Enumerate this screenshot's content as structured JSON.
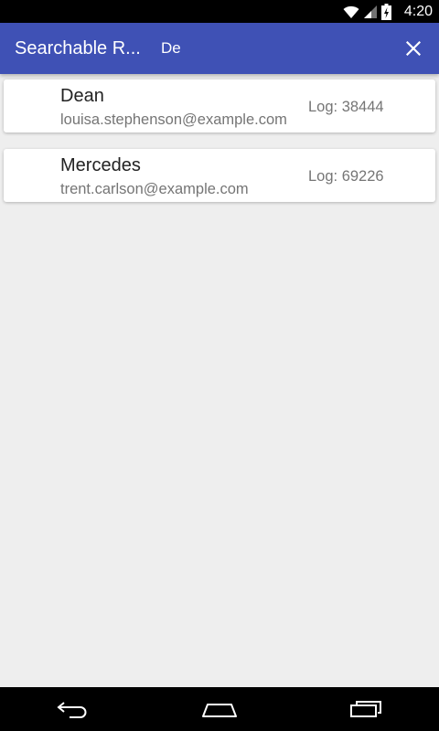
{
  "status_bar": {
    "time": "4:20",
    "icons": [
      "wifi-icon",
      "signal-icon",
      "battery-charging-icon"
    ]
  },
  "app_bar": {
    "title": "Searchable R...",
    "search_value": "De",
    "close_icon": "close-icon",
    "color": "#3f51b5"
  },
  "results": [
    {
      "name": "Dean",
      "email": "louisa.stephenson@example.com",
      "log": "Log: 38444"
    },
    {
      "name": "Mercedes",
      "email": "trent.carlson@example.com",
      "log": "Log: 69226"
    }
  ],
  "nav_bar": {
    "icons": [
      "back-icon",
      "home-icon",
      "recents-icon"
    ]
  }
}
